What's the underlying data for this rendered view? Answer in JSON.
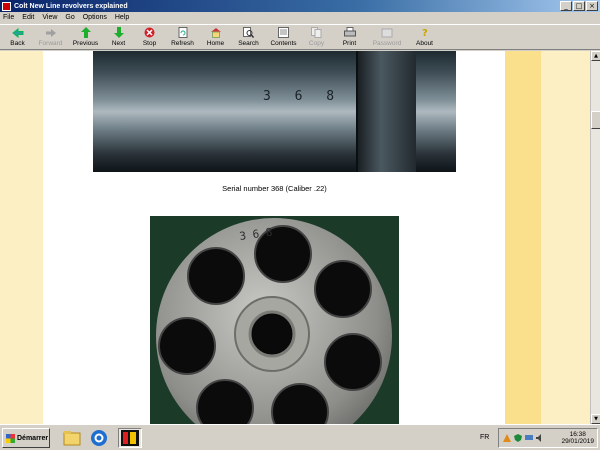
{
  "window": {
    "title": "Colt New Line revolvers explained"
  },
  "menu": [
    "File",
    "Edit",
    "View",
    "Go",
    "Options",
    "Help"
  ],
  "toolbar": [
    {
      "label": "Back",
      "icon": "back-arrow-icon",
      "enabled": true
    },
    {
      "label": "Forward",
      "icon": "forward-arrow-icon",
      "enabled": false
    },
    {
      "label": "Previous",
      "icon": "up-arrow-icon",
      "enabled": true
    },
    {
      "label": "Next",
      "icon": "down-arrow-icon",
      "enabled": true
    },
    {
      "label": "Stop",
      "icon": "stop-icon",
      "enabled": true
    },
    {
      "label": "Refresh",
      "icon": "refresh-icon",
      "enabled": true
    },
    {
      "label": "Home",
      "icon": "home-icon",
      "enabled": true
    },
    {
      "label": "Search",
      "icon": "search-icon",
      "enabled": true
    },
    {
      "label": "Contents",
      "icon": "contents-icon",
      "enabled": true
    },
    {
      "label": "Copy",
      "icon": "copy-icon",
      "enabled": false
    },
    {
      "label": "Print",
      "icon": "print-icon",
      "enabled": true
    },
    {
      "label": "Password",
      "icon": "password-icon",
      "enabled": false
    },
    {
      "label": "About",
      "icon": "about-icon",
      "enabled": true
    }
  ],
  "page": {
    "photo1_stamp": "3 6 8",
    "caption1": "Serial number 368 (Caliber .22)",
    "photo2_stamp": "3 6 8"
  },
  "taskbar": {
    "start_label": "Démarrer",
    "language": "FR",
    "time": "16:38",
    "date": "29/01/2019"
  }
}
